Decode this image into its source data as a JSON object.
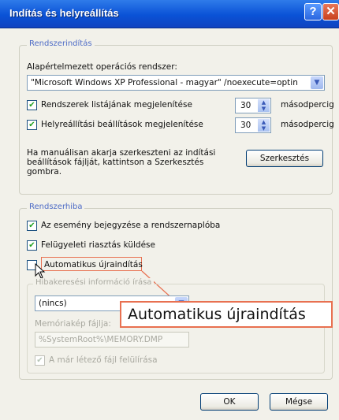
{
  "window": {
    "title": "Indítás és helyreállítás",
    "help_label": "?",
    "close_label": "✕"
  },
  "startup": {
    "legend": "Rendszerindítás",
    "default_os_label": "Alapértelmezett operációs rendszer:",
    "default_os_value": "\"Microsoft Windows XP Professional - magyar\" /noexecute=optin",
    "show_os_list_label": "Rendszerek listájának megjelenítése",
    "show_os_list_checked": true,
    "show_os_list_value": "30",
    "show_recovery_label": "Helyreállítási beállítások megjelenítése",
    "show_recovery_checked": true,
    "show_recovery_value": "30",
    "seconds_unit": "másodpercig",
    "manual_edit_text": "Ha manuálisan akarja szerkeszteni az indítási beállítások fájlját, kattintson a Szerkesztés gombra.",
    "edit_button": "Szerkesztés"
  },
  "system_failure": {
    "legend": "Rendszerhiba",
    "write_event_label": "Az esemény bejegyzése a rendszernaplóba",
    "write_event_checked": true,
    "send_alert_label": "Felügyeleti riasztás küldése",
    "send_alert_checked": true,
    "auto_restart_label": "Automatikus újraindítás",
    "auto_restart_checked": false,
    "debug_info_legend": "Hibakeresési információ írása",
    "debug_info_value": "(nincs)",
    "dump_file_label": "Memóriakép fájlja:",
    "dump_file_value": "%SystemRoot%\\MEMORY.DMP",
    "overwrite_label": "A már létező fájl felülírása",
    "overwrite_checked": true
  },
  "callout": {
    "text": "Automatikus újraindítás"
  },
  "buttons": {
    "ok": "OK",
    "cancel": "Mégse"
  },
  "colors": {
    "titlebar": "#0a52d6",
    "legend": "#4d6bc6",
    "callout_border": "#e87050",
    "checkmark": "#21a121"
  }
}
